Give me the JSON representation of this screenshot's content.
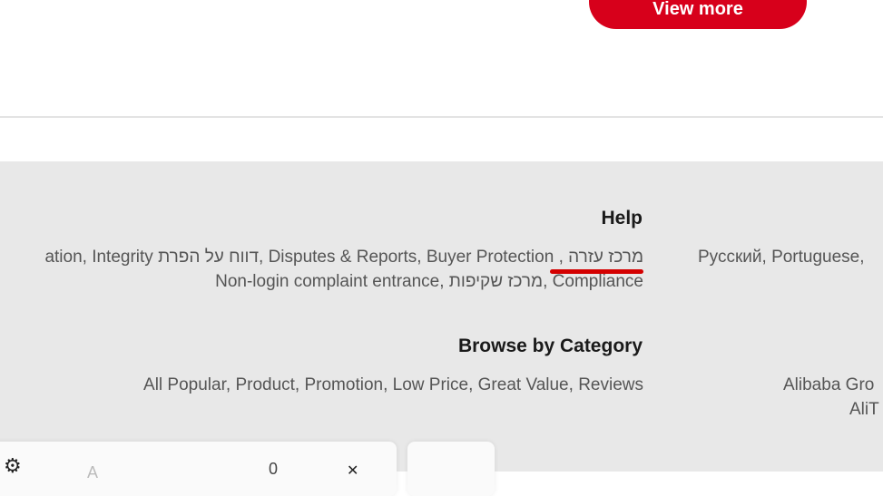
{
  "top": {
    "view_more": "View more"
  },
  "help": {
    "title": "Help",
    "row1": [
      "ation",
      "Integrity",
      "דווח על הפרת",
      "Disputes & Reports",
      "Buyer Protection",
      "מרכז עזרה"
    ],
    "row2": [
      "Non-login complaint entrance",
      "מרכז שקיפות",
      "Compliance"
    ]
  },
  "languages": {
    "row1": [
      "Русский",
      "Portuguese"
    ]
  },
  "browse": {
    "title": "Browse by Category",
    "items": [
      "All Popular",
      "Product",
      "Promotion",
      "Low Price",
      "Great Value",
      "Reviews"
    ]
  },
  "group": {
    "line1": "Alibaba Gro",
    "line2": "AliT"
  },
  "bottom_bar": {
    "settings_icon": "gear-icon",
    "faint_text": "A",
    "count": "0",
    "close_icon": "close-icon"
  }
}
